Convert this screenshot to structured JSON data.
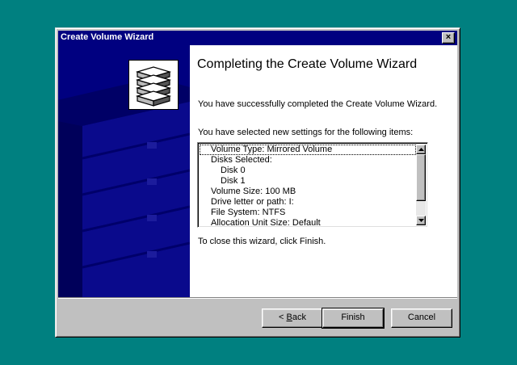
{
  "window": {
    "title": "Create Volume Wizard",
    "close_glyph": "×"
  },
  "wizard": {
    "heading": "Completing the Create Volume Wizard",
    "success_text": "You have successfully completed the Create Volume Wizard.",
    "settings_intro": "You have selected new settings for the following items:",
    "settings": [
      {
        "text": "Volume Type: Mirrored Volume",
        "indent": 0
      },
      {
        "text": "Disks Selected:",
        "indent": 0
      },
      {
        "text": "Disk 0",
        "indent": 1
      },
      {
        "text": "Disk 1",
        "indent": 1
      },
      {
        "text": "Volume Size: 100 MB",
        "indent": 0
      },
      {
        "text": "Drive letter or path: I:",
        "indent": 0
      },
      {
        "text": "File System: NTFS",
        "indent": 0
      },
      {
        "text": "Allocation Unit Size: Default",
        "indent": 0
      }
    ],
    "close_instruction": "To close this wizard, click Finish."
  },
  "buttons": {
    "back_prefix": "< ",
    "back_mnemonic": "B",
    "back_rest": "ack",
    "finish": "Finish",
    "cancel": "Cancel"
  },
  "colors": {
    "desktop": "#008080",
    "titlebar": "#000080",
    "sidebar": "#000080",
    "face": "#c0c0c0"
  },
  "icons": {
    "logo": "stacked-disks-icon",
    "sidebar_art": "server-rack-watermark"
  }
}
